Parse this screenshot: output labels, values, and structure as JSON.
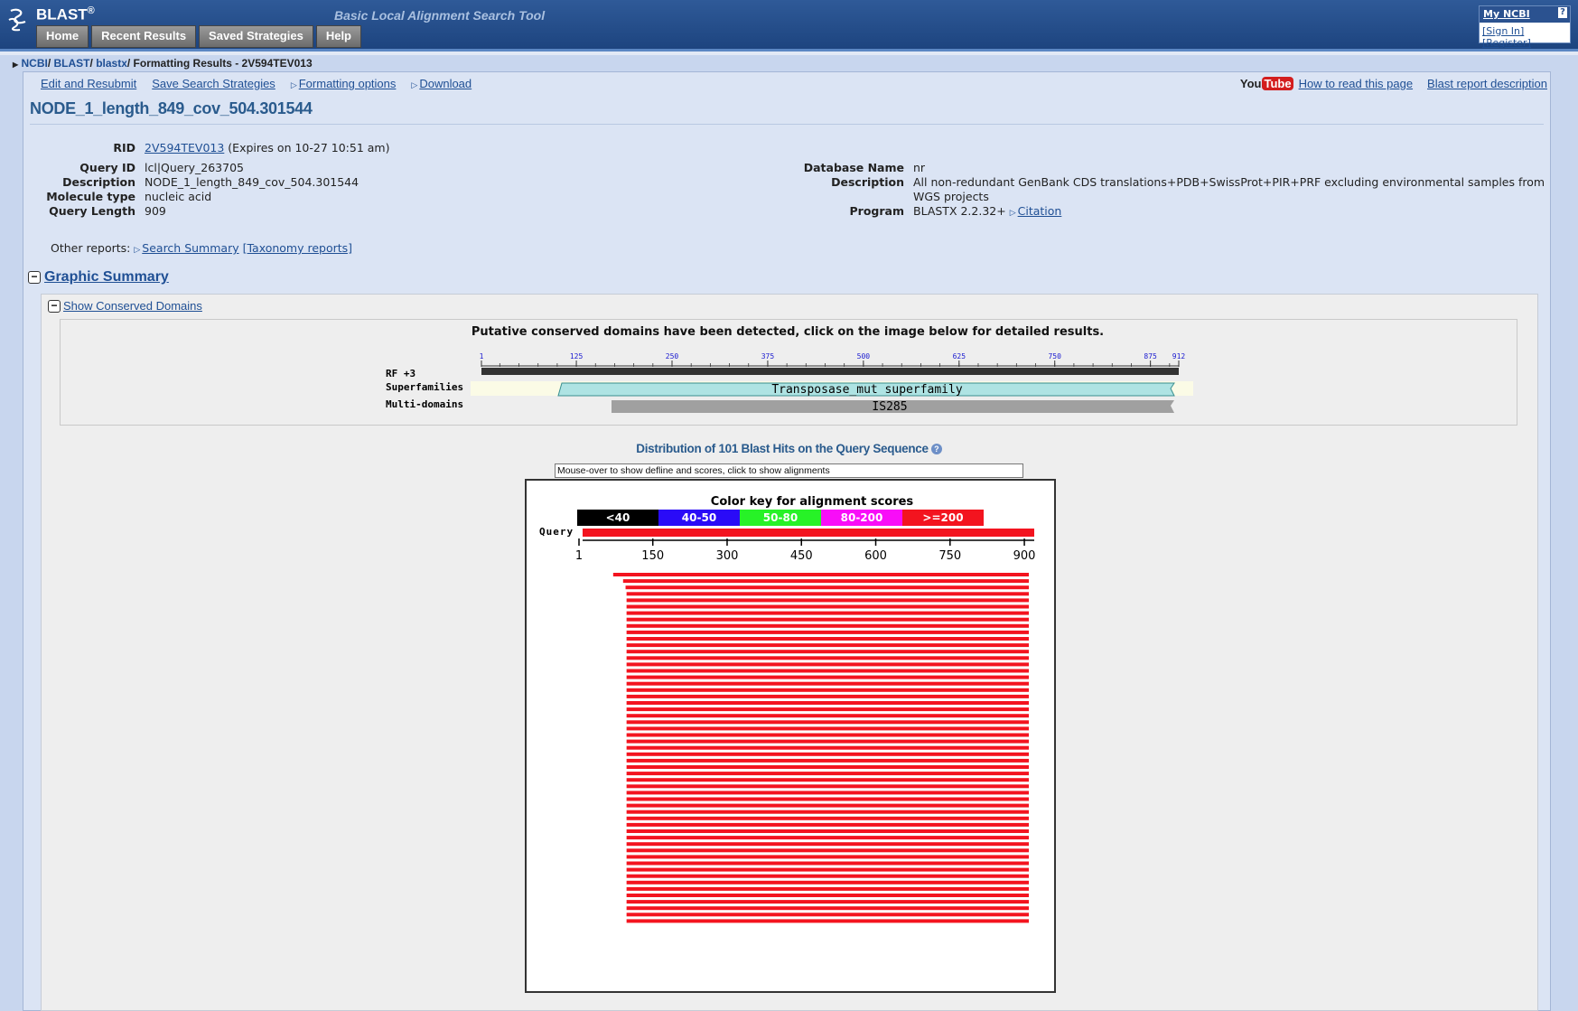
{
  "header": {
    "logo": "BLAST",
    "logo_reg": "®",
    "tagline": "Basic Local Alignment Search Tool",
    "nav": [
      "Home",
      "Recent Results",
      "Saved Strategies",
      "Help"
    ],
    "myncbi": "My NCBI",
    "help_q": "?",
    "signin": "[Sign In]",
    "register": "[Register]"
  },
  "breadcrumb": {
    "ncbi": "NCBI",
    "blast": "BLAST",
    "blastx": "blastx",
    "current": "Formatting Results - 2V594TEV013"
  },
  "toolbar": {
    "edit": "Edit and Resubmit",
    "save": "Save Search Strategies",
    "formatting": "Formatting options",
    "download": "Download",
    "youtube_you": "You",
    "youtube_tube": "Tube",
    "how_to_read": "How to read this page",
    "report_desc": "Blast report description"
  },
  "title": "NODE_1_length_849_cov_504.301544",
  "query_info": {
    "rid_label": "RID",
    "rid": "2V594TEV013",
    "rid_expires": "(Expires on 10-27 10:51 am)",
    "query_id_label": "Query ID",
    "query_id": "lcl|Query_263705",
    "description_label": "Description",
    "description": "NODE_1_length_849_cov_504.301544",
    "molecule_label": "Molecule type",
    "molecule": "nucleic acid",
    "length_label": "Query Length",
    "length": "909"
  },
  "db_info": {
    "dbname_label": "Database Name",
    "dbname": "nr",
    "description_label": "Description",
    "description_line1": "All non-redundant GenBank CDS translations+PDB+SwissProt+PIR+PRF excluding environmental samples from",
    "description_line2": "WGS projects",
    "program_label": "Program",
    "program": "BLASTX 2.2.32+",
    "citation": "Citation"
  },
  "other_reports": {
    "label": "Other reports:",
    "search_summary": "Search Summary",
    "taxonomy": "[Taxonomy reports]"
  },
  "graphic_summary": {
    "heading": "Graphic Summary",
    "show_cd": "Show Conserved Domains",
    "cd_notice": "Putative conserved domains have been detected, click on the image below for detailed results.",
    "cd_ticks": [
      "1",
      "125",
      "250",
      "375",
      "500",
      "625",
      "750",
      "875",
      "912"
    ],
    "rows": [
      "RF +3",
      "Superfamilies",
      "Multi-domains"
    ],
    "superfamily": "Transposase_mut superfamily",
    "multidomain": "IS285",
    "domain_colors": {
      "superfamily": "#aee3e3",
      "multidomain": "#a0a0a0",
      "frame": "#333333"
    }
  },
  "distribution": {
    "title": "Distribution of 101 Blast Hits on the Query Sequence",
    "help_icon": "help-icon",
    "mouseover": "Mouse-over to show defline and scores, click to show alignments",
    "color_key_title": "Color key for alignment scores",
    "color_key": [
      {
        "label": "<40",
        "color": "#000000"
      },
      {
        "label": "40-50",
        "color": "#2a0bf7"
      },
      {
        "label": "50-80",
        "color": "#27f227"
      },
      {
        "label": "80-200",
        "color": "#f80df8"
      },
      {
        "label": ">=200",
        "color": "#f3141f"
      }
    ],
    "query_label": "Query",
    "axis_ticks": [
      "1",
      "150",
      "300",
      "450",
      "600",
      "750",
      "900"
    ]
  },
  "chart_data": {
    "type": "bar",
    "x_range": [
      1,
      909
    ],
    "hits": [
      {
        "start": 70,
        "end": 909,
        "score": ">=200"
      },
      {
        "start": 90,
        "end": 909,
        "score": ">=200"
      },
      {
        "start": 95,
        "end": 909,
        "score": ">=200"
      }
    ],
    "repeat_hit": {
      "start": 97,
      "end": 909,
      "score": ">=200",
      "count": 52
    }
  }
}
